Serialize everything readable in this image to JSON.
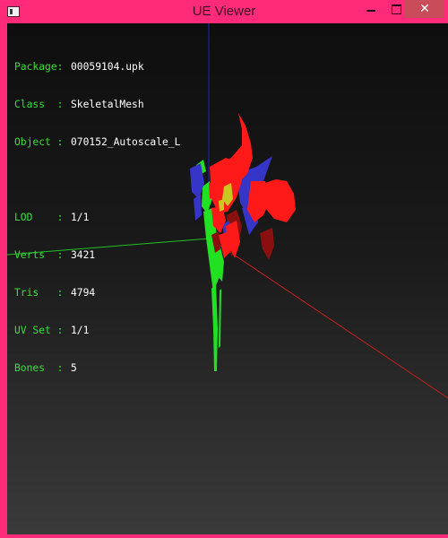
{
  "window": {
    "title": "UE Viewer"
  },
  "controls": {
    "minimize": "minimize",
    "maximize": "maximize",
    "close": "✕"
  },
  "colors": {
    "frame": "#ff2a78",
    "close": "#c94c5a",
    "label": "#38e038",
    "value": "#ffffff"
  },
  "info": {
    "package": {
      "key": "Package:",
      "value": "00059104.upk"
    },
    "class": {
      "key": "Class  :",
      "value": "SkeletalMesh"
    },
    "object": {
      "key": "Object :",
      "value": "070152_Autoscale_L"
    },
    "lod": {
      "key": "LOD    :",
      "value": "1/1"
    },
    "verts": {
      "key": "Verts  :",
      "value": "3421"
    },
    "tris": {
      "key": "Tris   :",
      "value": "4794"
    },
    "uvset": {
      "key": "UV Set :",
      "value": "1/1"
    },
    "bones": {
      "key": "Bones  :",
      "value": "5"
    }
  },
  "icons": {
    "app": "app-icon",
    "close": "close-icon",
    "minimize": "minimize-icon",
    "maximize": "maximize-icon"
  }
}
